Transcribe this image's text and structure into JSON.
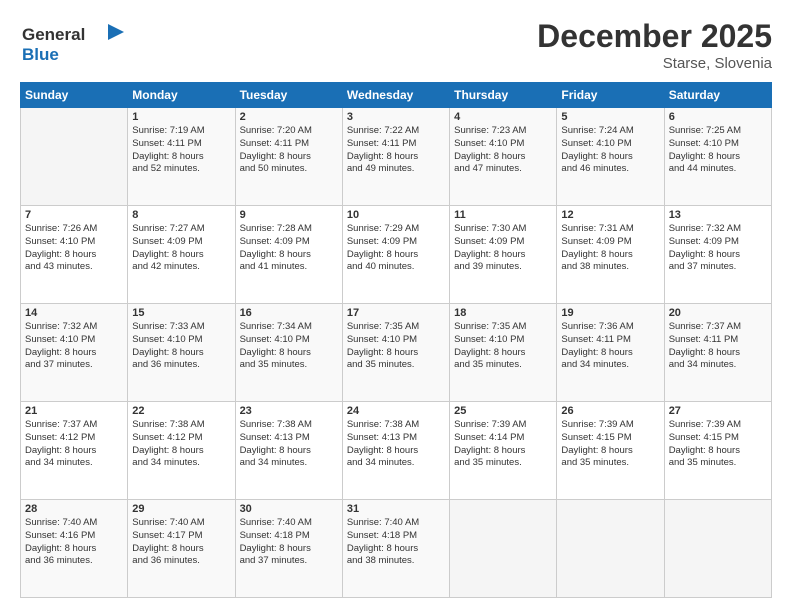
{
  "logo": {
    "line1": "General",
    "line2": "Blue"
  },
  "title": "December 2025",
  "location": "Starse, Slovenia",
  "header_days": [
    "Sunday",
    "Monday",
    "Tuesday",
    "Wednesday",
    "Thursday",
    "Friday",
    "Saturday"
  ],
  "weeks": [
    [
      {
        "day": "",
        "content": ""
      },
      {
        "day": "1",
        "content": "Sunrise: 7:19 AM\nSunset: 4:11 PM\nDaylight: 8 hours\nand 52 minutes."
      },
      {
        "day": "2",
        "content": "Sunrise: 7:20 AM\nSunset: 4:11 PM\nDaylight: 8 hours\nand 50 minutes."
      },
      {
        "day": "3",
        "content": "Sunrise: 7:22 AM\nSunset: 4:11 PM\nDaylight: 8 hours\nand 49 minutes."
      },
      {
        "day": "4",
        "content": "Sunrise: 7:23 AM\nSunset: 4:10 PM\nDaylight: 8 hours\nand 47 minutes."
      },
      {
        "day": "5",
        "content": "Sunrise: 7:24 AM\nSunset: 4:10 PM\nDaylight: 8 hours\nand 46 minutes."
      },
      {
        "day": "6",
        "content": "Sunrise: 7:25 AM\nSunset: 4:10 PM\nDaylight: 8 hours\nand 44 minutes."
      }
    ],
    [
      {
        "day": "7",
        "content": "Sunrise: 7:26 AM\nSunset: 4:10 PM\nDaylight: 8 hours\nand 43 minutes."
      },
      {
        "day": "8",
        "content": "Sunrise: 7:27 AM\nSunset: 4:09 PM\nDaylight: 8 hours\nand 42 minutes."
      },
      {
        "day": "9",
        "content": "Sunrise: 7:28 AM\nSunset: 4:09 PM\nDaylight: 8 hours\nand 41 minutes."
      },
      {
        "day": "10",
        "content": "Sunrise: 7:29 AM\nSunset: 4:09 PM\nDaylight: 8 hours\nand 40 minutes."
      },
      {
        "day": "11",
        "content": "Sunrise: 7:30 AM\nSunset: 4:09 PM\nDaylight: 8 hours\nand 39 minutes."
      },
      {
        "day": "12",
        "content": "Sunrise: 7:31 AM\nSunset: 4:09 PM\nDaylight: 8 hours\nand 38 minutes."
      },
      {
        "day": "13",
        "content": "Sunrise: 7:32 AM\nSunset: 4:09 PM\nDaylight: 8 hours\nand 37 minutes."
      }
    ],
    [
      {
        "day": "14",
        "content": "Sunrise: 7:32 AM\nSunset: 4:10 PM\nDaylight: 8 hours\nand 37 minutes."
      },
      {
        "day": "15",
        "content": "Sunrise: 7:33 AM\nSunset: 4:10 PM\nDaylight: 8 hours\nand 36 minutes."
      },
      {
        "day": "16",
        "content": "Sunrise: 7:34 AM\nSunset: 4:10 PM\nDaylight: 8 hours\nand 35 minutes."
      },
      {
        "day": "17",
        "content": "Sunrise: 7:35 AM\nSunset: 4:10 PM\nDaylight: 8 hours\nand 35 minutes."
      },
      {
        "day": "18",
        "content": "Sunrise: 7:35 AM\nSunset: 4:10 PM\nDaylight: 8 hours\nand 35 minutes."
      },
      {
        "day": "19",
        "content": "Sunrise: 7:36 AM\nSunset: 4:11 PM\nDaylight: 8 hours\nand 34 minutes."
      },
      {
        "day": "20",
        "content": "Sunrise: 7:37 AM\nSunset: 4:11 PM\nDaylight: 8 hours\nand 34 minutes."
      }
    ],
    [
      {
        "day": "21",
        "content": "Sunrise: 7:37 AM\nSunset: 4:12 PM\nDaylight: 8 hours\nand 34 minutes."
      },
      {
        "day": "22",
        "content": "Sunrise: 7:38 AM\nSunset: 4:12 PM\nDaylight: 8 hours\nand 34 minutes."
      },
      {
        "day": "23",
        "content": "Sunrise: 7:38 AM\nSunset: 4:13 PM\nDaylight: 8 hours\nand 34 minutes."
      },
      {
        "day": "24",
        "content": "Sunrise: 7:38 AM\nSunset: 4:13 PM\nDaylight: 8 hours\nand 34 minutes."
      },
      {
        "day": "25",
        "content": "Sunrise: 7:39 AM\nSunset: 4:14 PM\nDaylight: 8 hours\nand 35 minutes."
      },
      {
        "day": "26",
        "content": "Sunrise: 7:39 AM\nSunset: 4:15 PM\nDaylight: 8 hours\nand 35 minutes."
      },
      {
        "day": "27",
        "content": "Sunrise: 7:39 AM\nSunset: 4:15 PM\nDaylight: 8 hours\nand 35 minutes."
      }
    ],
    [
      {
        "day": "28",
        "content": "Sunrise: 7:40 AM\nSunset: 4:16 PM\nDaylight: 8 hours\nand 36 minutes."
      },
      {
        "day": "29",
        "content": "Sunrise: 7:40 AM\nSunset: 4:17 PM\nDaylight: 8 hours\nand 36 minutes."
      },
      {
        "day": "30",
        "content": "Sunrise: 7:40 AM\nSunset: 4:18 PM\nDaylight: 8 hours\nand 37 minutes."
      },
      {
        "day": "31",
        "content": "Sunrise: 7:40 AM\nSunset: 4:18 PM\nDaylight: 8 hours\nand 38 minutes."
      },
      {
        "day": "",
        "content": ""
      },
      {
        "day": "",
        "content": ""
      },
      {
        "day": "",
        "content": ""
      }
    ]
  ]
}
